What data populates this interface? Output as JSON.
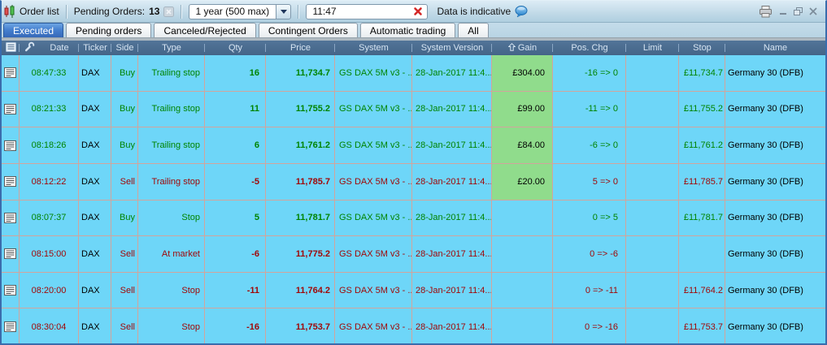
{
  "colors": {
    "frame": "#3a6cac",
    "body_bg": "#6ed6f8",
    "grid_line": "#d2a49c",
    "header_bg": "#527498",
    "header_bg2": "#446588",
    "header_text": "#d6e4f2",
    "buy_green": "#008400",
    "sell_red": "#a00808",
    "gain_bg": "#90dc8c",
    "tab_active_bg": "#4680cf",
    "tab_active_bg2": "#3568b8"
  },
  "toolbar": {
    "order_list_label": "Order list",
    "pending_orders_label": "Pending Orders:",
    "pending_orders_count": "13",
    "period_value": "1 year (500 max)",
    "time_value": "11:47",
    "indicative_label": "Data is indicative",
    "icons": [
      "candlestick-icon",
      "disabled-clear-icon",
      "dropdown-arrow-icon",
      "clear-red-x-icon",
      "speech-bubble-icon",
      "printer-icon",
      "minimize-icon",
      "restore-icon",
      "close-icon"
    ]
  },
  "tabs": [
    {
      "label": "Executed",
      "active": true
    },
    {
      "label": "Pending orders",
      "active": false
    },
    {
      "label": "Canceled/Rejected",
      "active": false
    },
    {
      "label": "Contingent Orders",
      "active": false
    },
    {
      "label": "Automatic trading",
      "active": false
    },
    {
      "label": "All",
      "active": false
    }
  ],
  "table": {
    "header": [
      {
        "icon": "document-icon"
      },
      {
        "icon": "wrench-icon"
      },
      {
        "label": "Date"
      },
      {
        "label": "Ticker"
      },
      {
        "label": "Side"
      },
      {
        "label": "Type"
      },
      {
        "label": "Qty"
      },
      {
        "label": "Price"
      },
      {
        "label": "System"
      },
      {
        "label": "System Version"
      },
      {
        "label": "Gain",
        "sort": "asc"
      },
      {
        "label": "Pos. Chg"
      },
      {
        "label": "Limit"
      },
      {
        "label": "Stop"
      },
      {
        "label": "Name"
      }
    ],
    "rows": [
      {
        "date": "08:47:33",
        "ticker": "DAX",
        "side": "Buy",
        "type": "Trailing stop",
        "qty": "16",
        "price": "11,734.7",
        "system": "GS DAX 5M v3 - ...",
        "system_version": "28-Jan-2017 11:4...",
        "gain": "£304.00",
        "pos_chg": "-16 => 0",
        "limit": "",
        "stop": "£11,734.7",
        "name": "Germany 30 (DFB)"
      },
      {
        "date": "08:21:33",
        "ticker": "DAX",
        "side": "Buy",
        "type": "Trailing stop",
        "qty": "11",
        "price": "11,755.2",
        "system": "GS DAX 5M v3 - ...",
        "system_version": "28-Jan-2017 11:4...",
        "gain": "£99.00",
        "pos_chg": "-11 => 0",
        "limit": "",
        "stop": "£11,755.2",
        "name": "Germany 30 (DFB)"
      },
      {
        "date": "08:18:26",
        "ticker": "DAX",
        "side": "Buy",
        "type": "Trailing stop",
        "qty": "6",
        "price": "11,761.2",
        "system": "GS DAX 5M v3 - ...",
        "system_version": "28-Jan-2017 11:4...",
        "gain": "£84.00",
        "pos_chg": "-6 => 0",
        "limit": "",
        "stop": "£11,761.2",
        "name": "Germany 30 (DFB)"
      },
      {
        "date": "08:12:22",
        "ticker": "DAX",
        "side": "Sell",
        "type": "Trailing stop",
        "qty": "-5",
        "price": "11,785.7",
        "system": "GS DAX 5M v3 - ...",
        "system_version": "28-Jan-2017 11:4...",
        "gain": "£20.00",
        "pos_chg": "5 => 0",
        "limit": "",
        "stop": "£11,785.7",
        "name": "Germany 30 (DFB)"
      },
      {
        "date": "08:07:37",
        "ticker": "DAX",
        "side": "Buy",
        "type": "Stop",
        "qty": "5",
        "price": "11,781.7",
        "system": "GS DAX 5M v3 - ...",
        "system_version": "28-Jan-2017 11:4...",
        "gain": "",
        "pos_chg": "0 => 5",
        "limit": "",
        "stop": "£11,781.7",
        "name": "Germany 30 (DFB)"
      },
      {
        "date": "08:15:00",
        "ticker": "DAX",
        "side": "Sell",
        "type": "At market",
        "qty": "-6",
        "price": "11,775.2",
        "system": "GS DAX 5M v3 - ...",
        "system_version": "28-Jan-2017 11:4...",
        "gain": "",
        "pos_chg": "0 => -6",
        "limit": "",
        "stop": "",
        "name": "Germany 30 (DFB)"
      },
      {
        "date": "08:20:00",
        "ticker": "DAX",
        "side": "Sell",
        "type": "Stop",
        "qty": "-11",
        "price": "11,764.2",
        "system": "GS DAX 5M v3 - ...",
        "system_version": "28-Jan-2017 11:4...",
        "gain": "",
        "pos_chg": "0 => -11",
        "limit": "",
        "stop": "£11,764.2",
        "name": "Germany 30 (DFB)"
      },
      {
        "date": "08:30:04",
        "ticker": "DAX",
        "side": "Sell",
        "type": "Stop",
        "qty": "-16",
        "price": "11,753.7",
        "system": "GS DAX 5M v3 - ...",
        "system_version": "28-Jan-2017 11:4...",
        "gain": "",
        "pos_chg": "0 => -16",
        "limit": "",
        "stop": "£11,753.7",
        "name": "Germany 30 (DFB)"
      }
    ]
  }
}
